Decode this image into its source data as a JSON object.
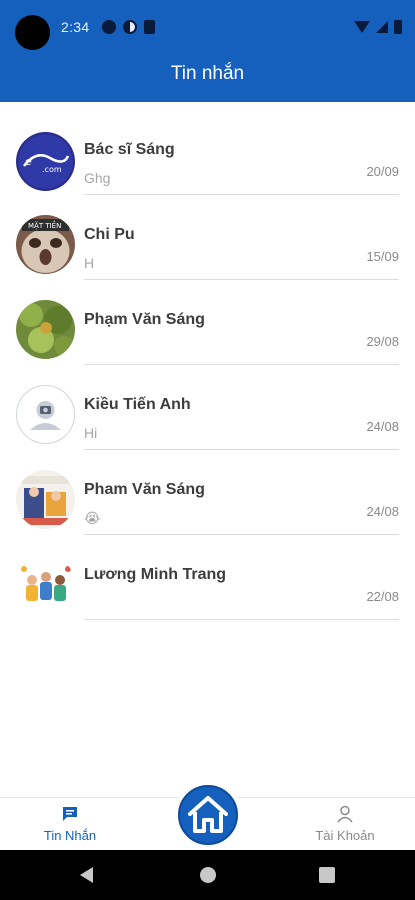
{
  "status": {
    "time": "2:34"
  },
  "header": {
    "title": "Tin nhắn"
  },
  "conversations": [
    {
      "name": "Bác sĩ Sáng",
      "preview": "Ghg",
      "date": "20/09",
      "avatar": "logo-avatar"
    },
    {
      "name": "Chi Pu",
      "preview": "H",
      "date": "15/09",
      "avatar": "cat-photo-avatar"
    },
    {
      "name": "Phạm Văn Sáng",
      "preview": "",
      "date": "29/08",
      "avatar": "plant-photo-avatar"
    },
    {
      "name": "Kiều Tiến Anh",
      "preview": "Hi",
      "date": "24/08",
      "avatar": "default-user-avatar"
    },
    {
      "name": "Pham Văn Sáng",
      "preview": "😭",
      "date": "24/08",
      "avatar": "illustration-avatar"
    },
    {
      "name": "Lương Minh Trang",
      "preview": "",
      "date": "22/08",
      "avatar": "group-illustration-avatar"
    }
  ],
  "bottom_nav": {
    "left_label": "Tin Nhắn",
    "right_label": "Tài Khoản",
    "left_icon": "chat-icon",
    "center_icon": "home-icon",
    "right_icon": "user-icon"
  },
  "colors": {
    "primary": "#1560bd",
    "muted": "#8a8a8a"
  }
}
